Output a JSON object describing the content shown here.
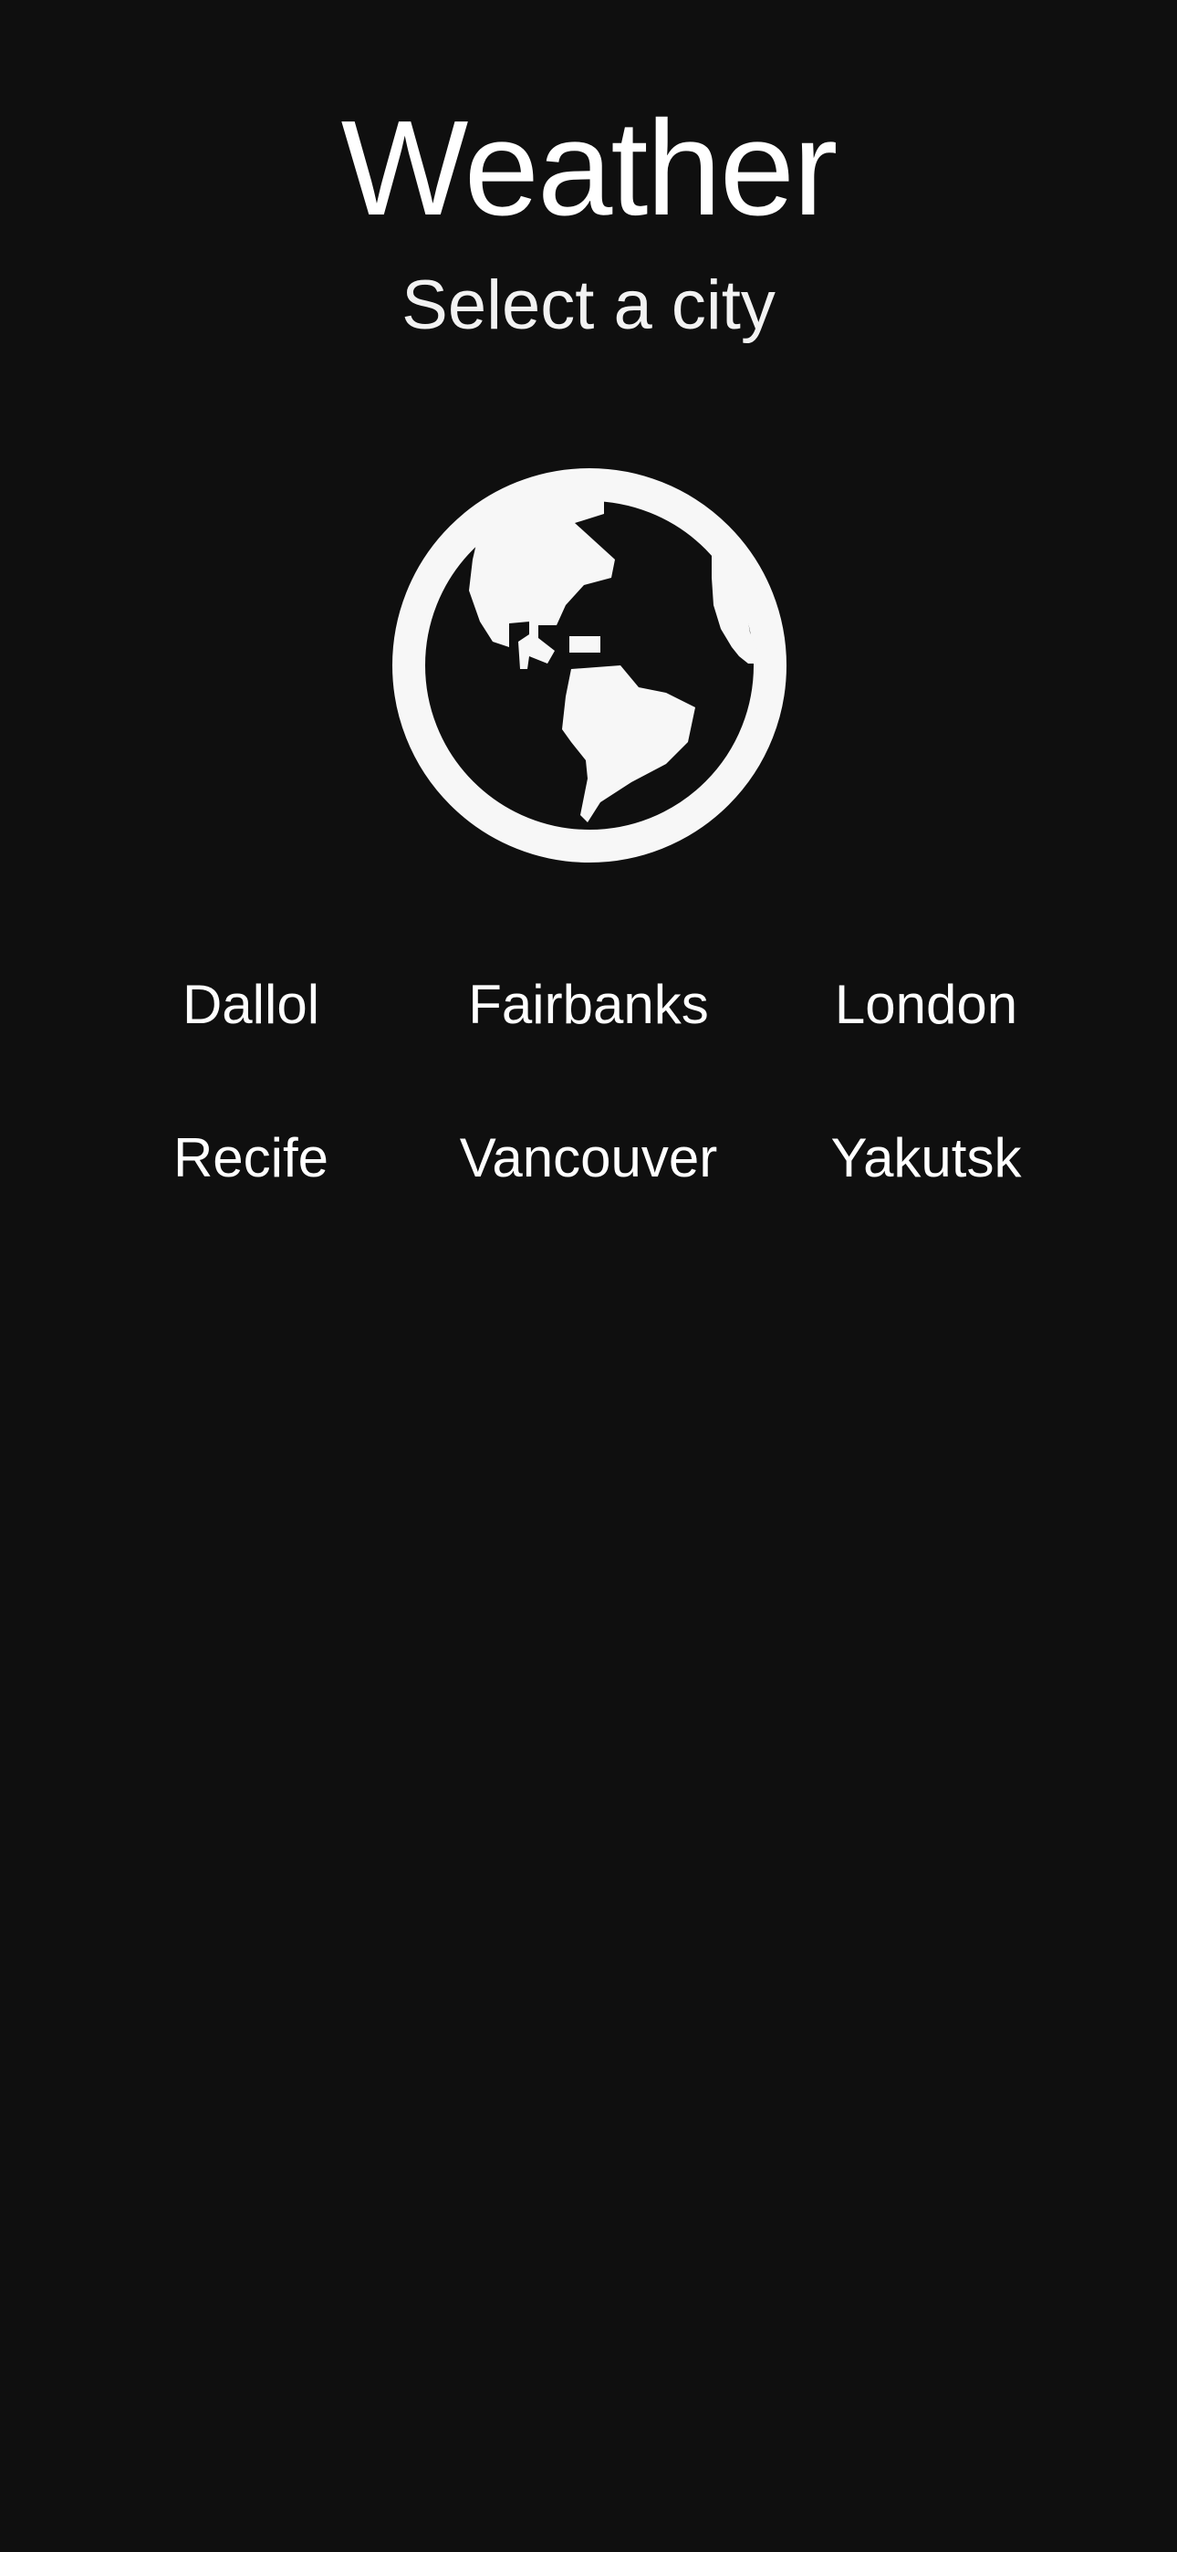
{
  "header": {
    "title": "Weather",
    "subtitle": "Select a city"
  },
  "icon": {
    "name": "globe-americas-icon",
    "color": "#f7f7f7"
  },
  "cities": [
    {
      "label": "Dallol"
    },
    {
      "label": "Fairbanks"
    },
    {
      "label": "London"
    },
    {
      "label": "Recife"
    },
    {
      "label": "Vancouver"
    },
    {
      "label": "Yakutsk"
    }
  ],
  "colors": {
    "background": "#0f0f0f",
    "text": "#ffffff"
  }
}
